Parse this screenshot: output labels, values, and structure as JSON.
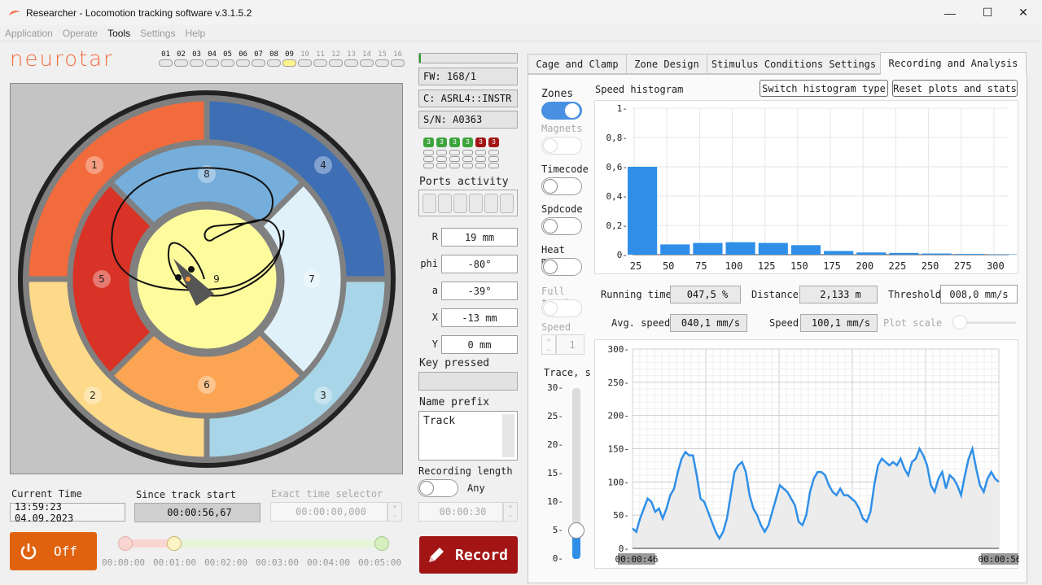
{
  "window": {
    "title": "Researcher - Locomotion tracking software v.3.1.5.2",
    "minimize": "—",
    "maximize": "☐",
    "close": "✕"
  },
  "menu": [
    "Application",
    "Operate",
    "Tools",
    "Settings",
    "Help"
  ],
  "logo": "neurotar",
  "channels": [
    "01",
    "02",
    "03",
    "04",
    "05",
    "06",
    "07",
    "08",
    "09",
    "10",
    "11",
    "12",
    "13",
    "14",
    "15",
    "16"
  ],
  "active_channel": "09",
  "arena": {
    "zone_labels": [
      "1",
      "2",
      "3",
      "4",
      "5",
      "6",
      "7",
      "8",
      "9"
    ],
    "colors": {
      "z1": "#f26b3d",
      "z2": "#fdd98a",
      "z3": "#a8d5e8",
      "z4": "#3e6fb5",
      "z5": "#d93226",
      "z6": "#fba554",
      "z7": "#e0f1f9",
      "z8": "#76aedb",
      "z9": "#fdfb9c"
    }
  },
  "info": {
    "fw": "FW: 168/1",
    "c": "C: ASRL4::INSTR",
    "sn": "S/N: A0363"
  },
  "ports": {
    "label": "Ports activity",
    "leds": [
      "3",
      "3",
      "3",
      "3",
      "3",
      "3"
    ]
  },
  "coords": [
    {
      "label": "R",
      "value": "19 mm"
    },
    {
      "label": "phi",
      "value": "-80°"
    },
    {
      "label": "a",
      "value": "-39°"
    },
    {
      "label": "X",
      "value": "-13 mm"
    },
    {
      "label": "Y",
      "value": "0 mm"
    }
  ],
  "key_pressed": {
    "label": "Key pressed",
    "value": ""
  },
  "name_prefix": {
    "label": "Name prefix",
    "value": "Track"
  },
  "recording_length": {
    "label": "Recording length",
    "toggle_label": "Any",
    "value": "00:00:30"
  },
  "record_button": "Record",
  "time": {
    "current_label": "Current Time",
    "current": "13:59:23 04.09.2023",
    "since_label": "Since track start",
    "since": "00:00:56,67",
    "exact_label": "Exact time selector",
    "exact": "00:00:00,000"
  },
  "off_button": "Off",
  "timeline": {
    "ticks": [
      "00:00:00",
      "00:01:00",
      "00:02:00",
      "00:03:00",
      "00:04:00",
      "00:05:00"
    ],
    "position": 0.2
  },
  "tabs": [
    "Cage and Clamp",
    "Zone Design",
    "Stimulus Conditions Settings",
    "Recording and Analysis"
  ],
  "active_tab": "Recording and Analysis",
  "toggles": [
    {
      "label": "Zones",
      "on": true,
      "enabled": true
    },
    {
      "label": "Magnets",
      "on": false,
      "enabled": false
    },
    {
      "label": "Timecode",
      "on": false,
      "enabled": true
    },
    {
      "label": "Spdcode",
      "on": false,
      "enabled": true
    },
    {
      "label": "Heat map",
      "on": false,
      "enabled": true
    },
    {
      "label": "Full track",
      "on": false,
      "enabled": false
    }
  ],
  "speed": {
    "label": "Speed",
    "value": "1"
  },
  "trace": {
    "label": "Trace, s",
    "ticks": [
      "30",
      "25",
      "20",
      "15",
      "10",
      "5",
      "0"
    ],
    "value": 5,
    "max": 30
  },
  "histogram": {
    "label": "Speed histogram",
    "switch_button": "Switch histogram type",
    "reset_button": "Reset plots and stats"
  },
  "stats": {
    "running_time_label": "Running time",
    "running_time": "047,5 %",
    "distance_label": "Distance",
    "distance": "2,133 m",
    "threshold_label": "Threshold",
    "threshold": "008,0 mm/s",
    "avg_speed_label": "Avg. speed",
    "avg_speed": "040,1 mm/s",
    "speed_label": "Speed",
    "speed": "100,1 mm/s",
    "plot_scale_label": "Plot scale"
  },
  "chart_data": [
    {
      "type": "bar",
      "title": "Speed histogram",
      "categories": [
        "25",
        "50",
        "75",
        "100",
        "125",
        "150",
        "175",
        "200",
        "225",
        "250",
        "275",
        "300"
      ],
      "values": [
        0.6,
        0.07,
        0.08,
        0.085,
        0.08,
        0.065,
        0.025,
        0.015,
        0.012,
        0.008,
        0.005,
        0.003
      ],
      "y_ticks": [
        "0",
        "0,2",
        "0,4",
        "0,6",
        "0,8",
        "1"
      ],
      "ylim": [
        0,
        1
      ],
      "grid": true,
      "color": "#2f8fe8"
    },
    {
      "type": "area",
      "x_start_label": "00:00:46",
      "x_end_label": "00:00:56",
      "y_ticks": [
        "0",
        "50",
        "100",
        "150",
        "200",
        "250",
        "300"
      ],
      "ylim": [
        0,
        300
      ],
      "grid": true,
      "color": "#2f8fe8",
      "values": [
        30,
        25,
        45,
        60,
        75,
        70,
        55,
        60,
        45,
        60,
        80,
        90,
        115,
        135,
        145,
        140,
        140,
        110,
        75,
        70,
        55,
        40,
        25,
        15,
        25,
        45,
        80,
        115,
        125,
        130,
        115,
        80,
        60,
        50,
        35,
        25,
        35,
        55,
        75,
        95,
        90,
        85,
        75,
        65,
        40,
        35,
        50,
        85,
        105,
        115,
        115,
        110,
        95,
        85,
        80,
        90,
        80,
        80,
        75,
        70,
        60,
        45,
        40,
        55,
        95,
        125,
        135,
        130,
        125,
        130,
        125,
        135,
        120,
        110,
        130,
        135,
        150,
        140,
        125,
        95,
        85,
        105,
        115,
        90,
        110,
        105,
        95,
        80,
        110,
        135,
        150,
        120,
        95,
        85,
        105,
        115,
        105,
        100
      ]
    }
  ]
}
